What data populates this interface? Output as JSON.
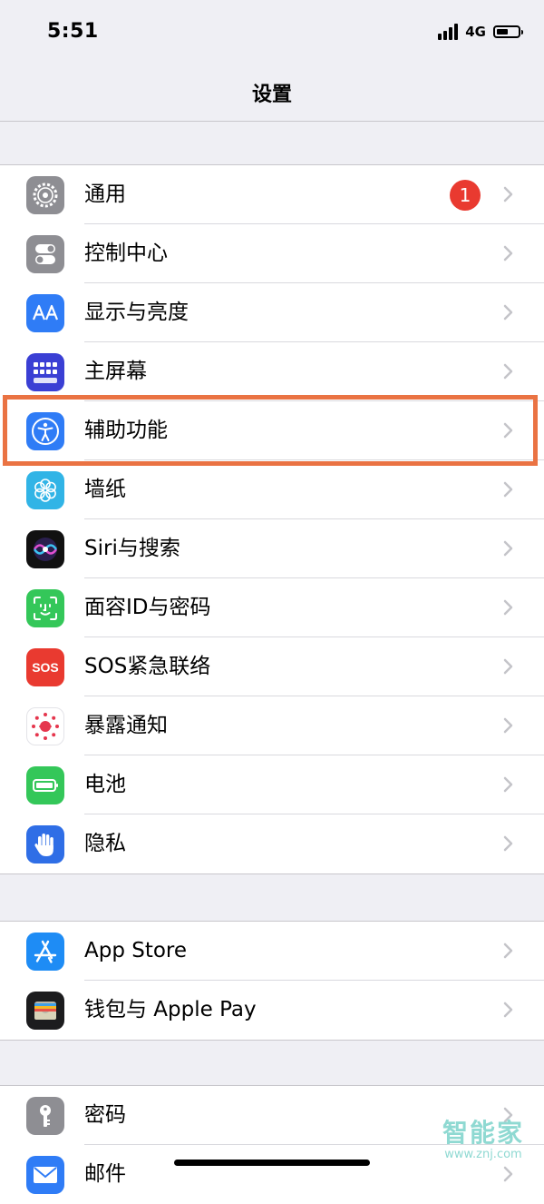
{
  "status_bar": {
    "time": "5:51",
    "network": "4G",
    "battery_level": 0.55
  },
  "nav": {
    "title": "设置"
  },
  "groups": [
    {
      "items": [
        {
          "label": "通用",
          "icon": "gear-icon",
          "badge": "1"
        },
        {
          "label": "控制中心",
          "icon": "toggle-switches-icon"
        },
        {
          "label": "显示与亮度",
          "icon": "text-size-aa-icon"
        },
        {
          "label": "主屏幕",
          "icon": "app-grid-icon"
        },
        {
          "label": "辅助功能",
          "icon": "accessibility-person-icon",
          "highlighted": true
        },
        {
          "label": "墙纸",
          "icon": "flower-icon"
        },
        {
          "label": "Siri与搜索",
          "icon": "siri-icon"
        },
        {
          "label": "面容ID与密码",
          "icon": "face-id-icon"
        },
        {
          "label": "SOS紧急联络",
          "icon": "sos-icon",
          "icon_text": "SOS"
        },
        {
          "label": "暴露通知",
          "icon": "exposure-dots-icon"
        },
        {
          "label": "电池",
          "icon": "battery-icon"
        },
        {
          "label": "隐私",
          "icon": "hand-icon"
        }
      ]
    },
    {
      "items": [
        {
          "label": "App Store",
          "icon": "app-store-icon"
        },
        {
          "label": "钱包与 Apple Pay",
          "icon": "wallet-icon"
        }
      ]
    },
    {
      "items": [
        {
          "label": "密码",
          "icon": "key-icon"
        },
        {
          "label": "邮件",
          "icon": "mail-icon"
        }
      ]
    }
  ],
  "highlight_color": "#ea7343",
  "watermark": {
    "name": "智能家",
    "url": "www.znj.com"
  }
}
